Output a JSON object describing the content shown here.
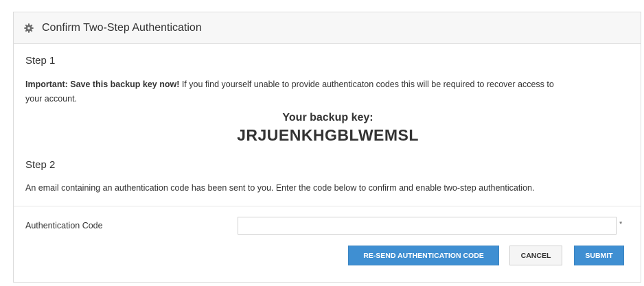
{
  "panel": {
    "title": "Confirm Two-Step Authentication",
    "icon": "gear-icon"
  },
  "step1": {
    "title": "Step 1",
    "important_label": "Important: Save this backup key now!",
    "message_line1": " If you find yourself unable to provide authenticaton codes this will be required to recover access to",
    "message_line2": "your account.",
    "backup_label": "Your backup key:",
    "backup_key": "JRJUENKHGBLWEMSL"
  },
  "step2": {
    "title": "Step 2",
    "message": "An email containing an authentication code has been sent to you. Enter the code below to confirm and enable two-step authentication."
  },
  "form": {
    "auth_code_label": "Authentication Code",
    "auth_code_value": "",
    "required_marker": "*"
  },
  "buttons": {
    "resend": "RE-SEND AUTHENTICATION CODE",
    "cancel": "CANCEL",
    "submit": "SUBMIT"
  },
  "colors": {
    "primary": "#3f8fd2",
    "header_bg": "#f7f7f7",
    "border": "#dcdcdc"
  }
}
